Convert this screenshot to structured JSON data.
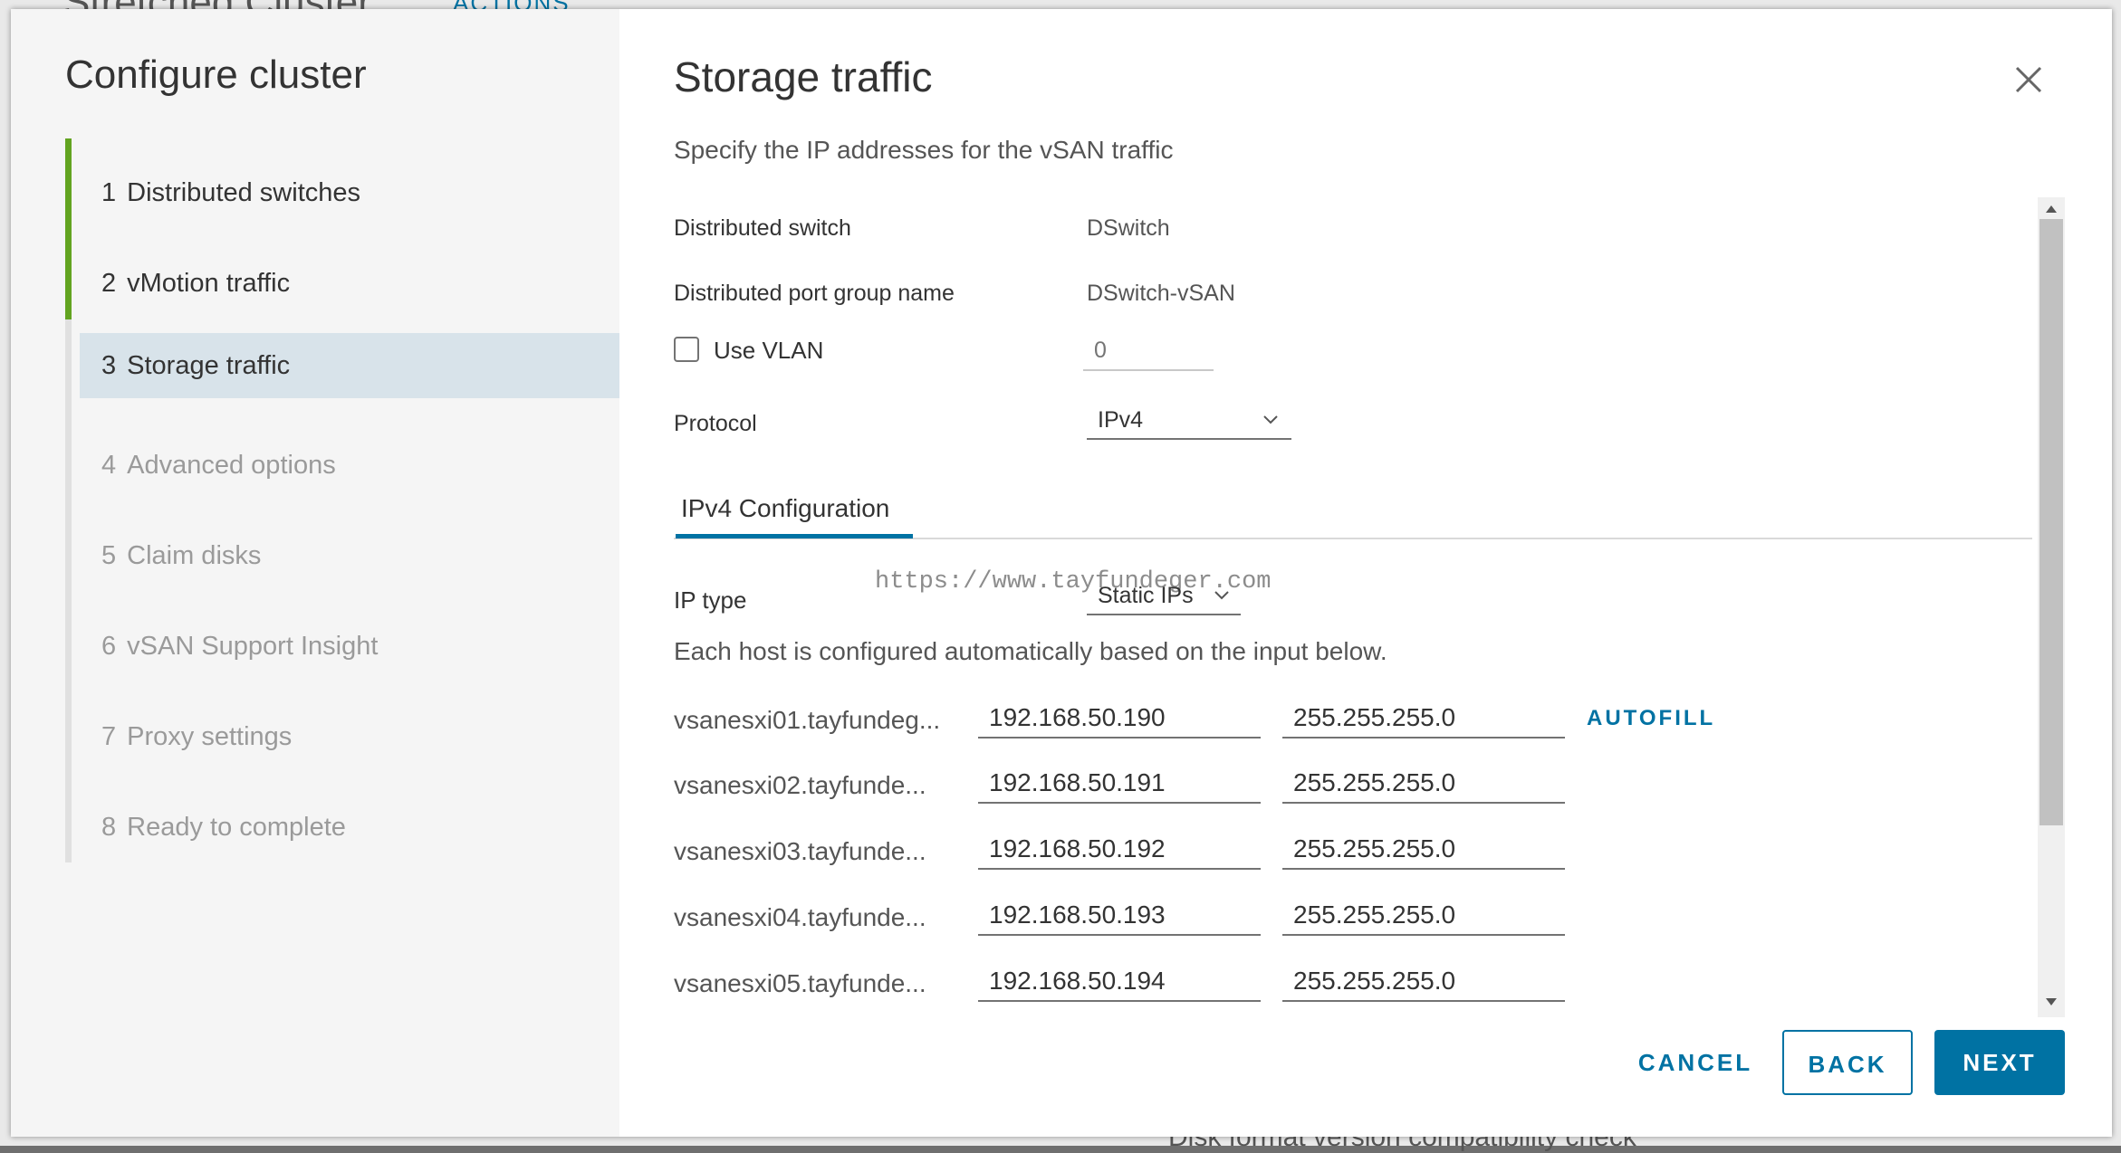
{
  "background": {
    "title": "Stretched Cluster",
    "actions_label": "ACTIONS",
    "bottom_text": "Disk format version compatibility check"
  },
  "sidebar": {
    "title": "Configure cluster",
    "steps": [
      {
        "num": "1",
        "label": "Distributed switches",
        "state": "done"
      },
      {
        "num": "2",
        "label": "vMotion traffic",
        "state": "done"
      },
      {
        "num": "3",
        "label": "Storage traffic",
        "state": "active"
      },
      {
        "num": "4",
        "label": "Advanced options",
        "state": "disabled"
      },
      {
        "num": "5",
        "label": "Claim disks",
        "state": "disabled"
      },
      {
        "num": "6",
        "label": "vSAN Support Insight",
        "state": "disabled"
      },
      {
        "num": "7",
        "label": "Proxy settings",
        "state": "disabled"
      },
      {
        "num": "8",
        "label": "Ready to complete",
        "state": "disabled"
      }
    ]
  },
  "main": {
    "title": "Storage traffic",
    "subtitle": "Specify the IP addresses for the vSAN traffic",
    "fields": {
      "switch_label": "Distributed switch",
      "switch_value": "DSwitch",
      "portgroup_label": "Distributed port group name",
      "portgroup_value": "DSwitch-vSAN",
      "vlan_label": "Use VLAN",
      "vlan_placeholder": "0",
      "protocol_label": "Protocol",
      "protocol_value": "IPv4"
    },
    "tab_label": "IPv4 Configuration",
    "watermark": "https://www.tayfundeger.com",
    "ip_type_label": "IP type",
    "ip_type_value": "Static IPs",
    "info_text": "Each host is configured automatically based on the input below.",
    "autofill_label": "AUTOFILL",
    "hosts": [
      {
        "name": "vsanesxi01.tayfundeg...",
        "ip": "192.168.50.190",
        "mask": "255.255.255.0"
      },
      {
        "name": "vsanesxi02.tayfunde...",
        "ip": "192.168.50.191",
        "mask": "255.255.255.0"
      },
      {
        "name": "vsanesxi03.tayfunde...",
        "ip": "192.168.50.192",
        "mask": "255.255.255.0"
      },
      {
        "name": "vsanesxi04.tayfunde...",
        "ip": "192.168.50.193",
        "mask": "255.255.255.0"
      },
      {
        "name": "vsanesxi05.tayfunde...",
        "ip": "192.168.50.194",
        "mask": "255.255.255.0"
      }
    ]
  },
  "footer": {
    "cancel": "CANCEL",
    "back": "BACK",
    "next": "NEXT"
  },
  "colors": {
    "accent": "#0072a3",
    "done_green": "#62a420",
    "active_step_bg": "#d8e3ea"
  }
}
